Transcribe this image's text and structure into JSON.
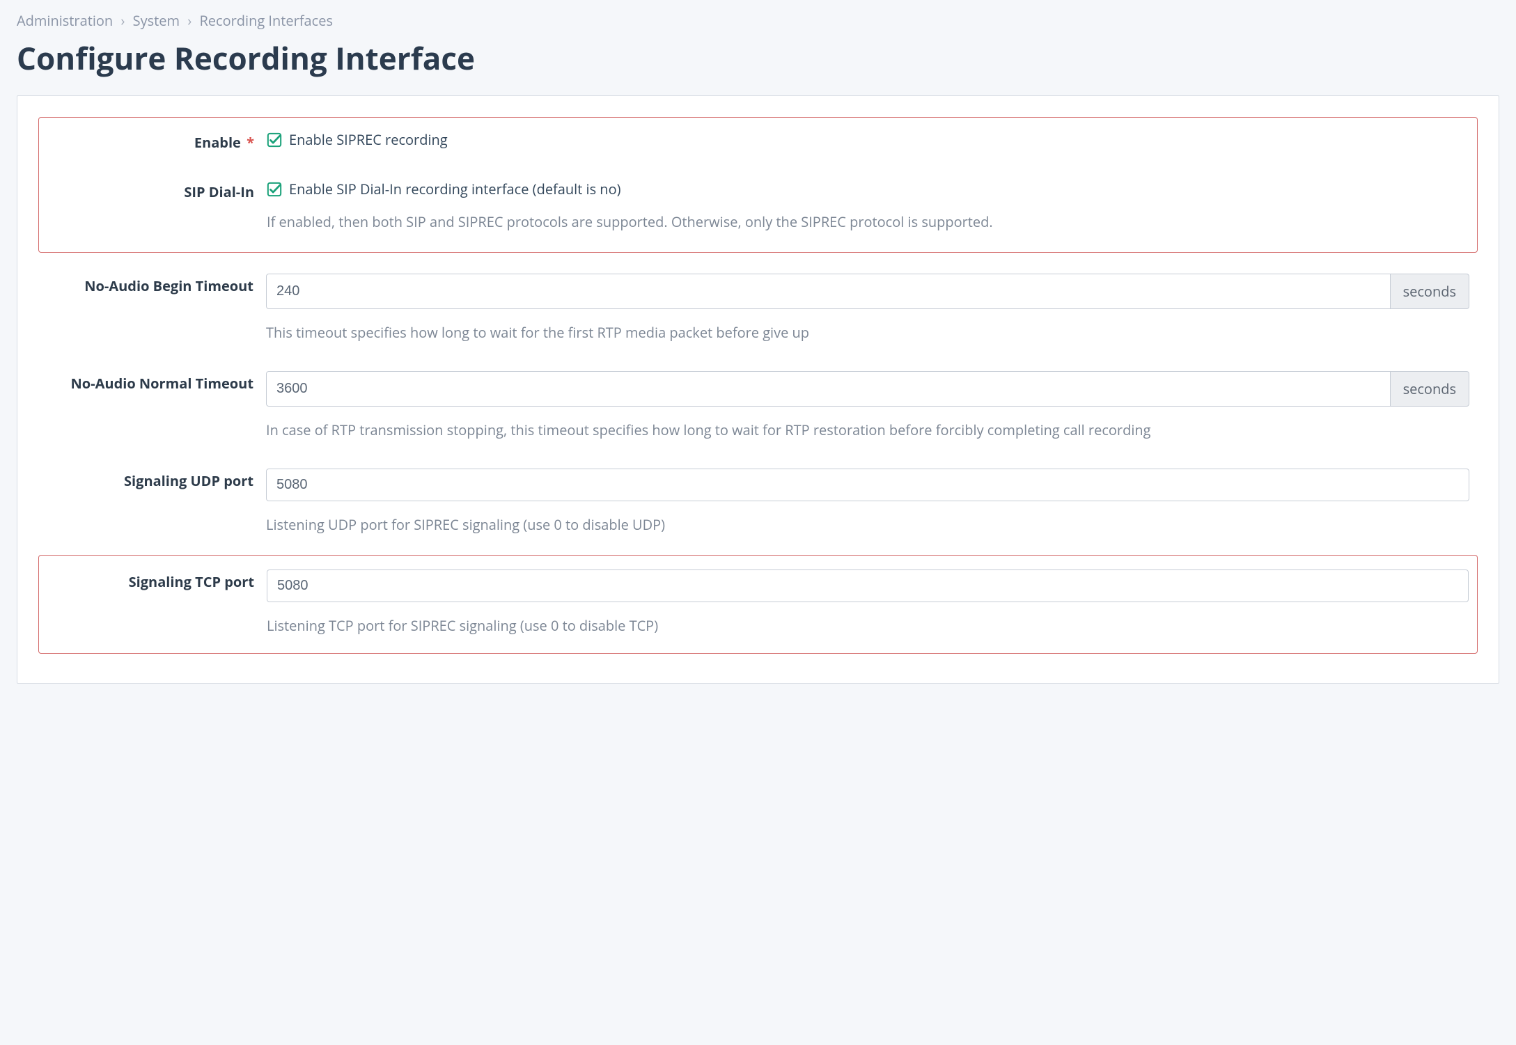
{
  "breadcrumb": {
    "a": "Administration",
    "b": "System",
    "c": "Recording Interfaces"
  },
  "page_title": "Configure Recording Interface",
  "fields": {
    "enable": {
      "label": "Enable",
      "required_mark": "*",
      "checkbox_label": "Enable SIPREC recording",
      "checked": true
    },
    "sip_dial_in": {
      "label": "SIP Dial-In",
      "checkbox_label": "Enable SIP Dial-In recording interface (default is no)",
      "checked": true,
      "help": "If enabled, then both SIP and SIPREC protocols are supported. Otherwise, only the SIPREC protocol is supported."
    },
    "no_audio_begin": {
      "label": "No-Audio Begin Timeout",
      "value": "240",
      "unit": "seconds",
      "help": "This timeout specifies how long to wait for the first RTP media packet before give up"
    },
    "no_audio_normal": {
      "label": "No-Audio Normal Timeout",
      "value": "3600",
      "unit": "seconds",
      "help": "In case of RTP transmission stopping, this timeout specifies how long to wait for RTP restoration before forcibly completing call recording"
    },
    "udp_port": {
      "label": "Signaling UDP port",
      "value": "5080",
      "help": "Listening UDP port for SIPREC signaling (use 0 to disable UDP)"
    },
    "tcp_port": {
      "label": "Signaling TCP port",
      "value": "5080",
      "help": "Listening TCP port for SIPREC signaling (use 0 to disable TCP)"
    }
  }
}
